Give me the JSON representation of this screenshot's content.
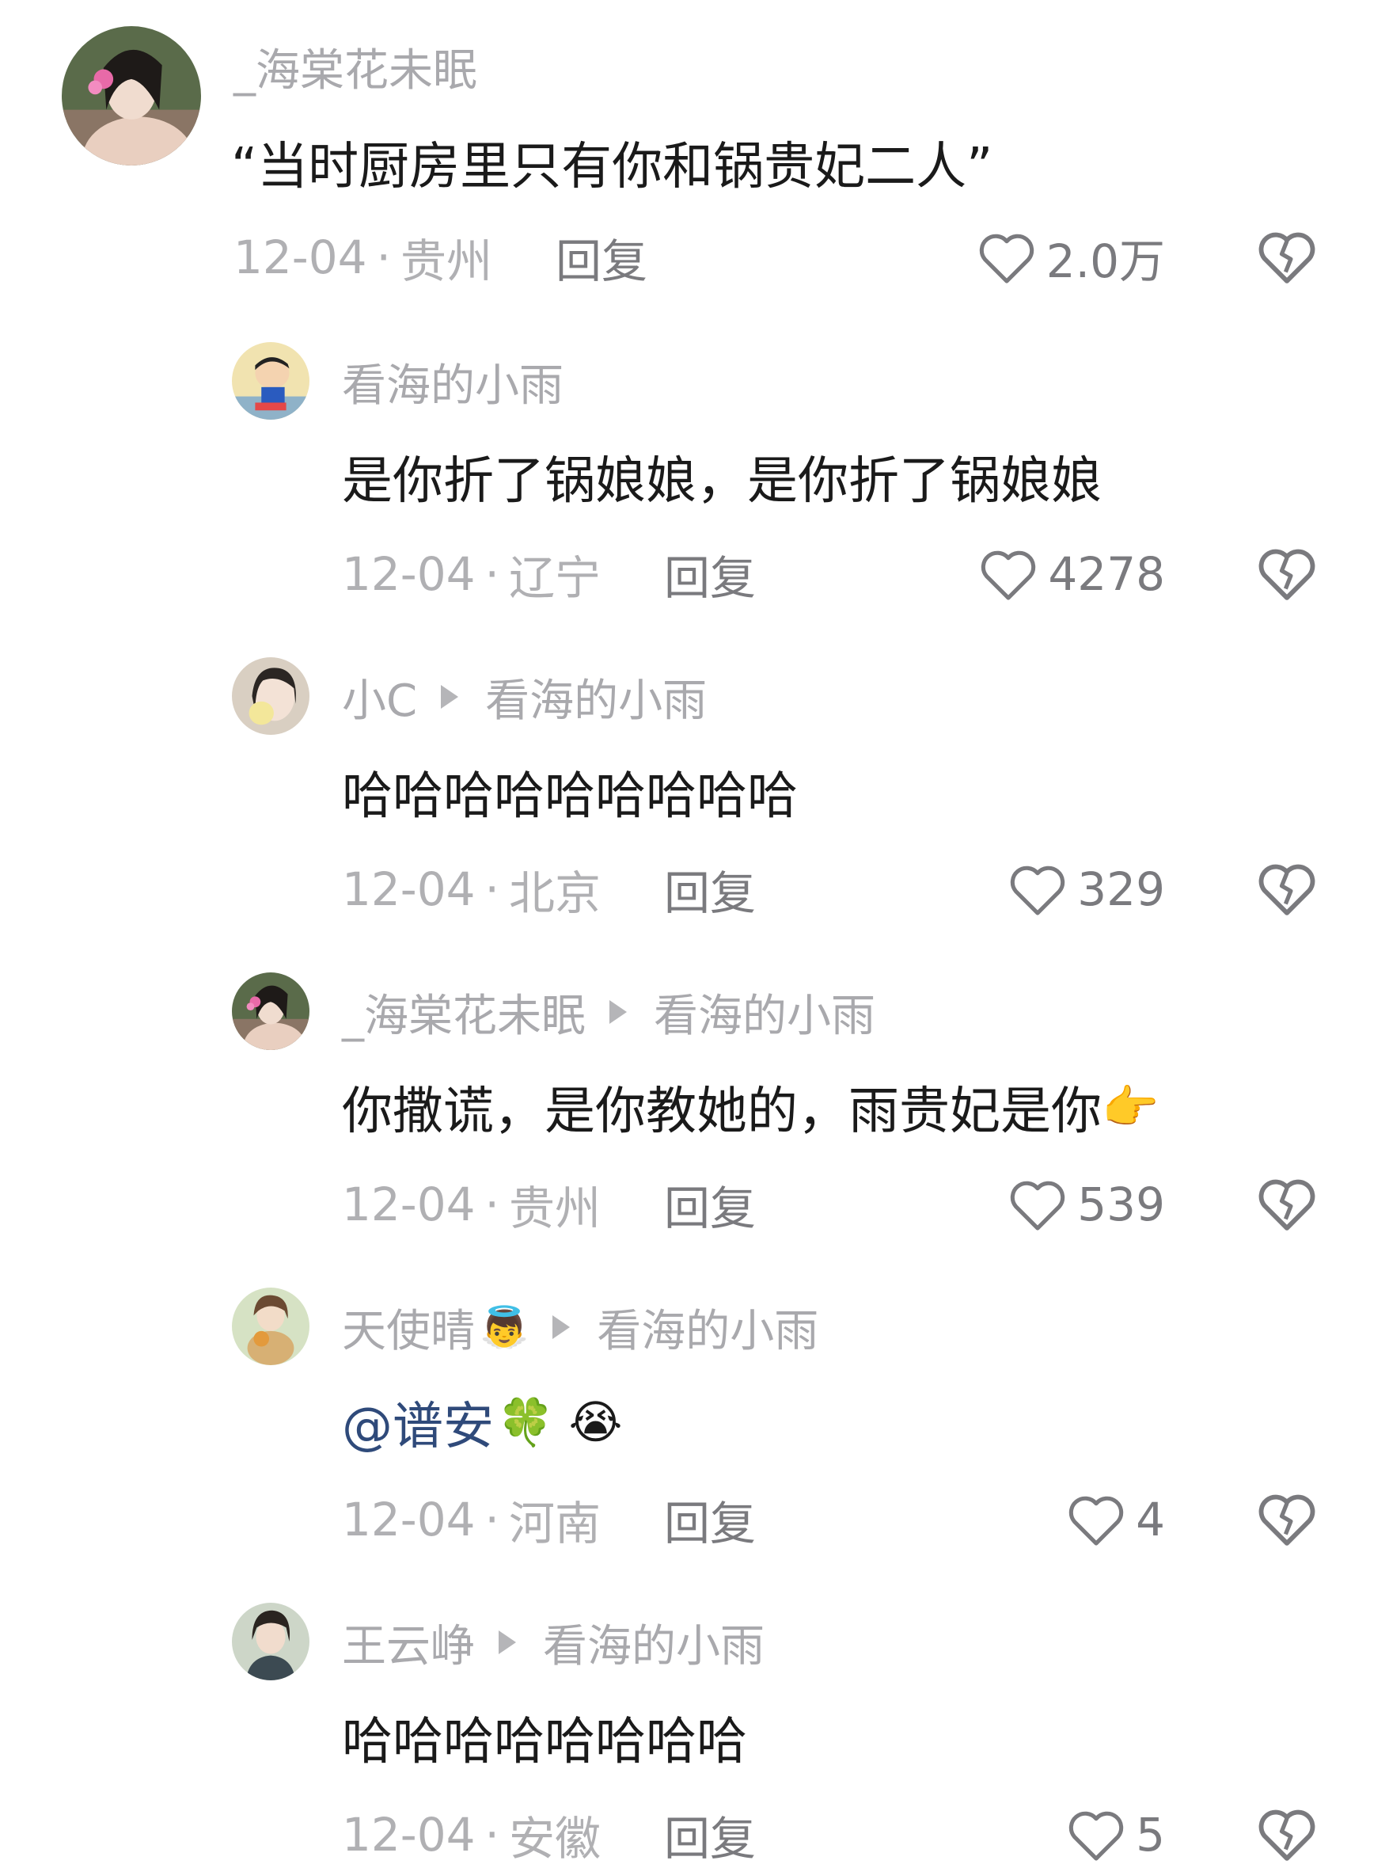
{
  "comments": [
    {
      "author": "_海棠花未眠",
      "reply_to": "",
      "text": "“当时厨房里只有你和锅贵妃二人”",
      "date": "12-04",
      "location": "贵州",
      "reply_label": "回复",
      "likes": "2.0万",
      "avatar": "woman-flower-avatar"
    },
    {
      "author": "看海的小雨",
      "reply_to": "",
      "text": "是你折了锅娘娘，是你折了锅娘娘",
      "date": "12-04",
      "location": "辽宁",
      "reply_label": "回复",
      "likes": "4278",
      "avatar": "cartoon-boy-avatar"
    },
    {
      "author": "小C",
      "reply_to": "看海的小雨",
      "text": "哈哈哈哈哈哈哈哈哈",
      "date": "12-04",
      "location": "北京",
      "reply_label": "回复",
      "likes": "329",
      "avatar": "girl-egg-avatar"
    },
    {
      "author": "_海棠花未眠",
      "reply_to": "看海的小雨",
      "text": "你撒谎，是你教她的，雨贵妃是你",
      "text_emoji": "👉",
      "date": "12-04",
      "location": "贵州",
      "reply_label": "回复",
      "likes": "539",
      "avatar": "woman-flower-avatar"
    },
    {
      "author": "天使晴",
      "author_emoji": "👼",
      "reply_to": "看海的小雨",
      "text": "@谱安",
      "text_emoji": "🍀 😭",
      "date": "12-04",
      "location": "河南",
      "reply_label": "回复",
      "likes": "4",
      "avatar": "girl-cat-avatar"
    },
    {
      "author": "王云峥",
      "reply_to": "看海的小雨",
      "text": "哈哈哈哈哈哈哈哈",
      "date": "12-04",
      "location": "安徽",
      "reply_label": "回复",
      "likes": "5",
      "avatar": "woman-portrait-avatar"
    }
  ],
  "separator": "·",
  "icons": {
    "like": "heart-outline-icon",
    "dislike": "broken-heart-icon",
    "reply_arrow": "triangle-right-icon"
  },
  "colors": {
    "name": "#a9a9ad",
    "text": "#1a1a1a",
    "meta": "#b0b0b3",
    "reply": "#7a7a7e",
    "mention": "#2f4a7a"
  }
}
